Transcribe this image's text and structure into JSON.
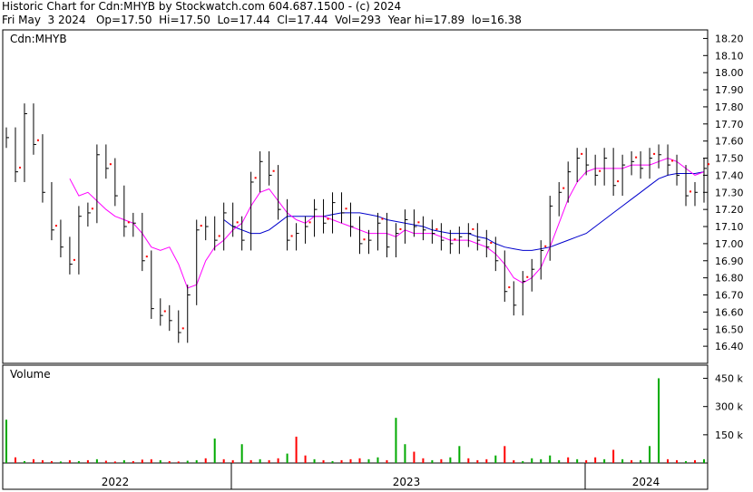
{
  "header": {
    "line1": "Historic Chart for Cdn:MHYB by Stockwatch.com 604.687.1500 - (c) 2024",
    "line2": "Fri May  3 2024   Op=17.50  Hi=17.50  Lo=17.44  Cl=17.44  Vol=293  Year hi=17.89  lo=16.38"
  },
  "colors": {
    "price": "#000000",
    "point": "#ff0000",
    "ma_short": "#ff00ff",
    "ma_long": "#0000cc",
    "vol_up": "#00aa00",
    "vol_down": "#ff0000",
    "grid": "#aaaaaa"
  },
  "chart_data": [
    {
      "type": "ohlc",
      "ticker_label": "Cdn:MHYB",
      "ylim": [
        16.3,
        18.25
      ],
      "yticks": [
        "18.20",
        "18.10",
        "18.00",
        "17.90",
        "17.80",
        "17.70",
        "17.60",
        "17.50",
        "17.40",
        "17.30",
        "17.20",
        "17.10",
        "17.00",
        "16.90",
        "16.80",
        "16.70",
        "16.60",
        "16.50",
        "16.40"
      ],
      "x_labels": [
        "2022",
        "2023",
        "2024"
      ],
      "x": [
        0,
        10,
        20,
        30,
        40,
        50,
        60,
        70,
        80,
        90,
        100,
        110,
        120,
        130,
        140,
        150,
        160,
        170,
        180,
        190,
        200,
        210,
        220,
        230,
        240,
        250,
        260,
        270,
        280,
        290,
        300,
        310,
        320,
        330,
        340,
        350,
        360,
        370,
        380,
        390,
        400,
        410,
        420,
        430,
        440,
        450,
        460,
        470,
        480,
        490,
        500,
        510,
        520,
        530,
        540,
        550,
        560,
        570,
        580,
        590,
        600,
        610,
        620,
        630,
        640,
        650,
        660,
        670,
        680,
        690,
        700,
        710,
        720,
        730,
        740,
        750,
        760,
        770
      ],
      "close": [
        17.62,
        17.42,
        17.76,
        17.58,
        17.3,
        17.08,
        16.98,
        16.88,
        17.16,
        17.18,
        17.52,
        17.44,
        17.28,
        17.1,
        17.12,
        16.9,
        16.62,
        16.58,
        16.55,
        16.48,
        16.7,
        17.08,
        17.1,
        17.02,
        17.18,
        17.1,
        17.02,
        17.36,
        17.48,
        17.4,
        17.2,
        17.02,
        17.06,
        17.1,
        17.2,
        17.12,
        17.24,
        17.18,
        17.1,
        17.0,
        17.02,
        17.12,
        16.98,
        17.06,
        17.14,
        17.1,
        17.08,
        17.06,
        17.02,
        17.0,
        17.04,
        17.06,
        17.02,
        16.98,
        16.9,
        16.72,
        16.64,
        16.78,
        16.85,
        16.96,
        17.22,
        17.3,
        17.42,
        17.5,
        17.46,
        17.4,
        17.5,
        17.34,
        17.46,
        17.48,
        17.44,
        17.5,
        17.52,
        17.46,
        17.4,
        17.28,
        17.3,
        17.44
      ],
      "ma_short": [
        null,
        null,
        null,
        null,
        null,
        null,
        null,
        17.38,
        17.28,
        17.3,
        17.25,
        17.2,
        17.16,
        17.14,
        17.12,
        17.06,
        16.98,
        16.96,
        16.98,
        16.88,
        16.74,
        16.76,
        16.9,
        16.98,
        17.02,
        17.08,
        17.12,
        17.22,
        17.3,
        17.32,
        17.25,
        17.18,
        17.14,
        17.12,
        17.16,
        17.16,
        17.14,
        17.12,
        17.1,
        17.08,
        17.06,
        17.06,
        17.06,
        17.04,
        17.08,
        17.06,
        17.06,
        17.06,
        17.04,
        17.02,
        17.02,
        17.02,
        17.0,
        16.98,
        16.94,
        16.88,
        16.8,
        16.77,
        16.8,
        16.86,
        16.98,
        17.12,
        17.26,
        17.36,
        17.42,
        17.44,
        17.44,
        17.44,
        17.44,
        17.46,
        17.46,
        17.46,
        17.48,
        17.5,
        17.48,
        17.44,
        17.4,
        17.42
      ],
      "ma_long": [
        null,
        null,
        null,
        null,
        null,
        null,
        null,
        null,
        null,
        null,
        null,
        null,
        null,
        null,
        null,
        null,
        null,
        null,
        null,
        null,
        null,
        null,
        null,
        null,
        17.14,
        17.1,
        17.08,
        17.06,
        17.06,
        17.08,
        17.12,
        17.16,
        17.16,
        17.16,
        17.16,
        17.16,
        17.17,
        17.18,
        17.18,
        17.18,
        17.17,
        17.16,
        17.14,
        17.13,
        17.12,
        17.11,
        17.1,
        17.08,
        17.07,
        17.06,
        17.06,
        17.06,
        17.04,
        17.03,
        17.0,
        16.98,
        16.97,
        16.96,
        16.96,
        16.97,
        16.98,
        17.0,
        17.02,
        17.04,
        17.06,
        17.1,
        17.14,
        17.18,
        17.22,
        17.26,
        17.3,
        17.34,
        17.38,
        17.4,
        17.41,
        17.41,
        17.41,
        17.42
      ],
      "volume_panel_label": "Volume",
      "volume_yticks": [
        "450 k",
        "300 k",
        "150 k"
      ],
      "volume_ylim": [
        0,
        520
      ],
      "volume": [
        230,
        30,
        10,
        20,
        15,
        10,
        8,
        15,
        10,
        15,
        20,
        12,
        8,
        15,
        10,
        18,
        20,
        15,
        10,
        8,
        12,
        15,
        25,
        130,
        20,
        15,
        100,
        15,
        20,
        15,
        25,
        50,
        140,
        40,
        20,
        15,
        10,
        15,
        20,
        25,
        20,
        30,
        15,
        240,
        100,
        60,
        25,
        15,
        20,
        30,
        90,
        25,
        15,
        20,
        40,
        90,
        15,
        10,
        25,
        20,
        40,
        15,
        30,
        20,
        15,
        30,
        20,
        70,
        20,
        15,
        15,
        90,
        450,
        20,
        15,
        10,
        15,
        20
      ],
      "volume_up": [
        1,
        0,
        1,
        0,
        0,
        0,
        1,
        0,
        1,
        0,
        1,
        0,
        0,
        1,
        0,
        0,
        0,
        1,
        0,
        0,
        1,
        1,
        0,
        1,
        0,
        0,
        1,
        0,
        1,
        0,
        0,
        1,
        0,
        0,
        1,
        0,
        1,
        0,
        0,
        0,
        1,
        1,
        0,
        1,
        1,
        0,
        0,
        1,
        0,
        1,
        1,
        0,
        0,
        0,
        1,
        0,
        0,
        1,
        1,
        1,
        1,
        1,
        0,
        1,
        0,
        0,
        1,
        0,
        1,
        0,
        1,
        1,
        1,
        0,
        0,
        1,
        0,
        1
      ]
    }
  ]
}
